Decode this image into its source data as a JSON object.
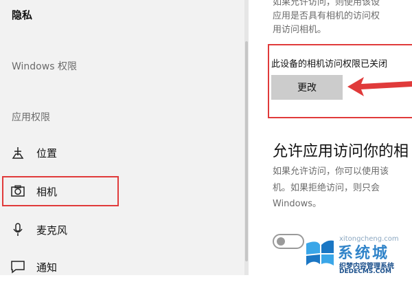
{
  "sidebar": {
    "title": "隐私",
    "windows_section": "Windows 权限",
    "app_section": "应用权限",
    "items": [
      {
        "label": "位置",
        "icon": "location-icon"
      },
      {
        "label": "相机",
        "icon": "camera-icon"
      },
      {
        "label": "麦克风",
        "icon": "microphone-icon"
      },
      {
        "label": "通知",
        "icon": "notification-icon"
      }
    ]
  },
  "main": {
    "intro_lines": [
      "如果允许访问，则使用该设",
      "应用是否具有相机的访问权",
      "用访问相机。"
    ],
    "status_text": "此设备的相机访问权限已关闭",
    "change_button": "更改",
    "allow_heading": "允许应用访问你的相",
    "allow_desc_lines": [
      "如果允许访问，你可以使用该",
      "机。如果拒绝访问，则只会",
      "Windows。"
    ],
    "toggle_state": "off"
  },
  "watermark": {
    "brand": "系统城",
    "url": "xitongcheng.com",
    "subtitle": "织梦内容管理系统",
    "domain": "DEDECMS.COM"
  },
  "colors": {
    "highlight": "#e03a3a",
    "sidebar_bg": "#f2f2f2",
    "button_bg": "#cccccc",
    "watermark_blue": "#1b77c4"
  }
}
